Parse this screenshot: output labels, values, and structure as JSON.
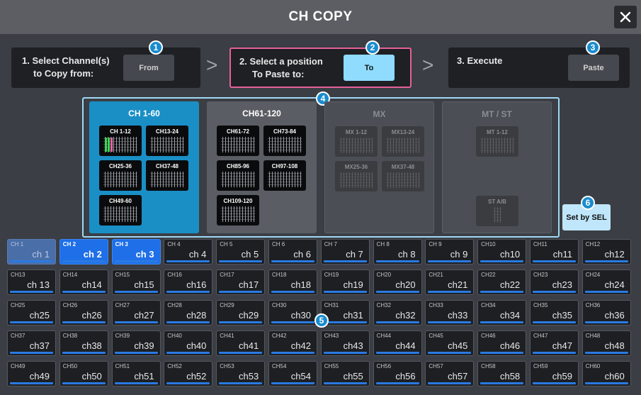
{
  "window": {
    "title": "CH COPY",
    "close_label": "✕"
  },
  "steps": {
    "step1": {
      "label_line1": "1. Select Channel(s)",
      "label_line2": "to Copy from:",
      "button": "From",
      "badge": "1"
    },
    "step2": {
      "label_line1": "2. Select a position",
      "label_line2": "To Paste to:",
      "button": "To",
      "badge": "2"
    },
    "step3": {
      "label": "3. Execute",
      "button": "Paste",
      "badge": "3"
    }
  },
  "bank_badge": "4",
  "grid_badge": "5",
  "banks": [
    {
      "title": "CH 1-60",
      "state": "selected",
      "groups": [
        "CH 1-12",
        "CH13-24",
        "CH25-36",
        "CH37-48",
        "CH49-60"
      ]
    },
    {
      "title": "CH61-120",
      "state": "normal",
      "groups": [
        "CH61-72",
        "CH73-84",
        "CH85-96",
        "CH97-108",
        "CH109-120"
      ]
    },
    {
      "title": "MX",
      "state": "disabled",
      "groups": [
        "MX 1-12",
        "MX13-24",
        "MX25-36",
        "MX37-48"
      ]
    },
    {
      "title": "MT / ST",
      "state": "disabled",
      "groups": [
        "MT 1-12",
        "ST A/B"
      ]
    }
  ],
  "set_by_sel": {
    "label": "Set by SEL",
    "badge": "6"
  },
  "channels": [
    {
      "num": "CH 1",
      "name": "ch 1",
      "state": "source"
    },
    {
      "num": "CH 2",
      "name": "ch 2",
      "state": "selected"
    },
    {
      "num": "CH 3",
      "name": "ch 3",
      "state": "selected"
    },
    {
      "num": "CH 4",
      "name": "ch 4"
    },
    {
      "num": "CH 5",
      "name": "ch 5"
    },
    {
      "num": "CH 6",
      "name": "ch 6"
    },
    {
      "num": "CH 7",
      "name": "ch 7"
    },
    {
      "num": "CH 8",
      "name": "ch 8"
    },
    {
      "num": "CH 9",
      "name": "ch 9"
    },
    {
      "num": "CH10",
      "name": "ch10"
    },
    {
      "num": "CH11",
      "name": "ch11"
    },
    {
      "num": "CH12",
      "name": "ch12"
    },
    {
      "num": "CH13",
      "name": "ch 13"
    },
    {
      "num": "CH14",
      "name": "ch14"
    },
    {
      "num": "CH15",
      "name": "ch15"
    },
    {
      "num": "CH16",
      "name": "ch16"
    },
    {
      "num": "CH17",
      "name": "ch17"
    },
    {
      "num": "CH18",
      "name": "ch18"
    },
    {
      "num": "CH19",
      "name": "ch19"
    },
    {
      "num": "CH20",
      "name": "ch20"
    },
    {
      "num": "CH21",
      "name": "ch21"
    },
    {
      "num": "CH22",
      "name": "ch22"
    },
    {
      "num": "CH23",
      "name": "ch23"
    },
    {
      "num": "CH24",
      "name": "ch24"
    },
    {
      "num": "CH25",
      "name": "ch25"
    },
    {
      "num": "CH26",
      "name": "ch26"
    },
    {
      "num": "CH27",
      "name": "ch27"
    },
    {
      "num": "CH28",
      "name": "ch28"
    },
    {
      "num": "CH29",
      "name": "ch29"
    },
    {
      "num": "CH30",
      "name": "ch30"
    },
    {
      "num": "CH31",
      "name": "ch31"
    },
    {
      "num": "CH32",
      "name": "ch32"
    },
    {
      "num": "CH33",
      "name": "ch33"
    },
    {
      "num": "CH34",
      "name": "ch34"
    },
    {
      "num": "CH35",
      "name": "ch35"
    },
    {
      "num": "CH36",
      "name": "ch36"
    },
    {
      "num": "CH37",
      "name": "ch37"
    },
    {
      "num": "CH38",
      "name": "ch38"
    },
    {
      "num": "CH39",
      "name": "ch39"
    },
    {
      "num": "CH40",
      "name": "ch40"
    },
    {
      "num": "CH41",
      "name": "ch41"
    },
    {
      "num": "CH42",
      "name": "ch42"
    },
    {
      "num": "CH43",
      "name": "ch43"
    },
    {
      "num": "CH44",
      "name": "ch44"
    },
    {
      "num": "CH45",
      "name": "ch45"
    },
    {
      "num": "CH46",
      "name": "ch46"
    },
    {
      "num": "CH47",
      "name": "ch47"
    },
    {
      "num": "CH48",
      "name": "ch48"
    },
    {
      "num": "CH49",
      "name": "ch49"
    },
    {
      "num": "CH50",
      "name": "ch50"
    },
    {
      "num": "CH51",
      "name": "ch51"
    },
    {
      "num": "CH52",
      "name": "ch52"
    },
    {
      "num": "CH53",
      "name": "ch53"
    },
    {
      "num": "CH54",
      "name": "ch54"
    },
    {
      "num": "CH55",
      "name": "ch55"
    },
    {
      "num": "CH56",
      "name": "ch56"
    },
    {
      "num": "CH57",
      "name": "ch57"
    },
    {
      "num": "CH58",
      "name": "ch58"
    },
    {
      "num": "CH59",
      "name": "ch59"
    },
    {
      "num": "CH60",
      "name": "ch60"
    }
  ],
  "colors": {
    "accent": "#1a8fc6",
    "selected_channel": "#1e6fe8",
    "button_lit": "#8fdcff",
    "frame": "#9fd8f5",
    "meter_green": "#3fd45a",
    "meter_pink": "#f05fa6"
  }
}
